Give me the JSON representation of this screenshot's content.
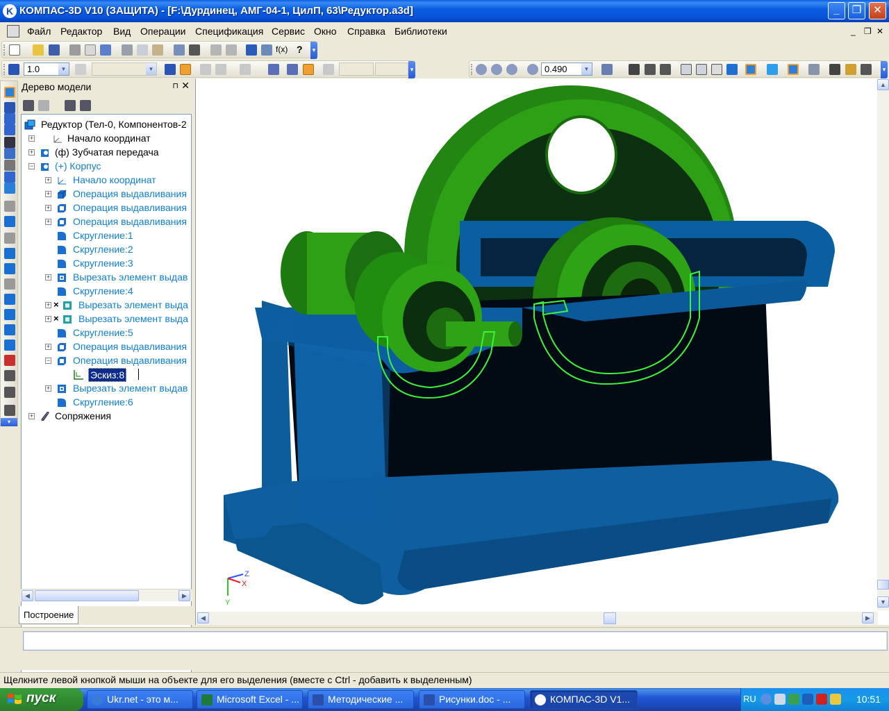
{
  "window": {
    "app_icon": "K",
    "title": "КОМПАС-3D V10 (ЗАЩИТА) - [F:\\Дурдинец, АМГ-04-1, ЦилП, 63\\Редуктор.a3d]",
    "minimize": "_",
    "maximize": "❐",
    "close": "✕"
  },
  "menu": {
    "items": [
      "Файл",
      "Редактор",
      "Вид",
      "Операции",
      "Спецификация",
      "Сервис",
      "Окно",
      "Справка",
      "Библиотеки"
    ],
    "mdi_minimize": "_",
    "mdi_restore": "❐",
    "mdi_close": "✕"
  },
  "toolbar": {
    "step_value": "1.0",
    "zoom_value": "0.490",
    "fx_label": "f(x)",
    "help_label": "?"
  },
  "tree": {
    "header": "Дерево модели",
    "pin": "⊓",
    "close": "✕",
    "items": [
      {
        "label": "Редуктор (Тел-0, Компонентов-2",
        "color": "#000000"
      },
      {
        "label": "Начало координат",
        "color": "#000000"
      },
      {
        "label": "(ф) Зубчатая передача",
        "color": "#000000"
      },
      {
        "label": "(+) Корпус",
        "color": "#0f7fd6"
      },
      {
        "label": "Начало координат",
        "color": "#0f7fd6"
      },
      {
        "label": "Операция выдавливания",
        "color": "#0f7fd6"
      },
      {
        "label": "Операция выдавливания",
        "color": "#0f7fd6"
      },
      {
        "label": "Операция выдавливания",
        "color": "#0f7fd6"
      },
      {
        "label": "Скругление:1",
        "color": "#0f7fd6"
      },
      {
        "label": "Скругление:2",
        "color": "#0f7fd6"
      },
      {
        "label": "Скругление:3",
        "color": "#0f7fd6"
      },
      {
        "label": "Вырезать элемент выдав",
        "color": "#0f7fd6"
      },
      {
        "label": "Скругление:4",
        "color": "#0f7fd6"
      },
      {
        "label": "Вырезать элемент выда",
        "color": "#0f7fd6"
      },
      {
        "label": "Вырезать элемент выда",
        "color": "#0f7fd6"
      },
      {
        "label": "Скругление:5",
        "color": "#0f7fd6"
      },
      {
        "label": "Операция выдавливания",
        "color": "#0f7fd6"
      },
      {
        "label": "Операция выдавливания",
        "color": "#0f7fd6"
      },
      {
        "label": "Эскиз:8",
        "color": "#ffffff"
      },
      {
        "label": "Вырезать элемент выдав",
        "color": "#0f7fd6"
      },
      {
        "label": "Скругление:6",
        "color": "#0f7fd6"
      },
      {
        "label": "Сопряжения",
        "color": "#000000"
      }
    ],
    "tab_label": "Построение"
  },
  "viewport": {
    "axis_z": "Z",
    "axis_x": "X",
    "axis_y": "Y",
    "colors": {
      "gear_green": "#2e9e10",
      "housing_blue": "#0f5a9a",
      "sketch_green": "#3df23d"
    }
  },
  "status": {
    "prompt_value": "",
    "hint": "Щелкните левой кнопкой мыши на объекте для его выделения (вместе с Ctrl - добавить к выделенным)"
  },
  "taskbar": {
    "start_label": "пуск",
    "tasks": [
      {
        "label": "Ukr.net - это м...",
        "icon": "ie-icon"
      },
      {
        "label": "Microsoft Excel - ...",
        "icon": "excel-icon"
      },
      {
        "label": "Методические ...",
        "icon": "word-icon"
      },
      {
        "label": "Рисунки.doc - ...",
        "icon": "word-icon"
      },
      {
        "label": "КОМПАС-3D V1...",
        "icon": "kompas-icon"
      }
    ],
    "language": "RU",
    "clock": "10:51"
  }
}
